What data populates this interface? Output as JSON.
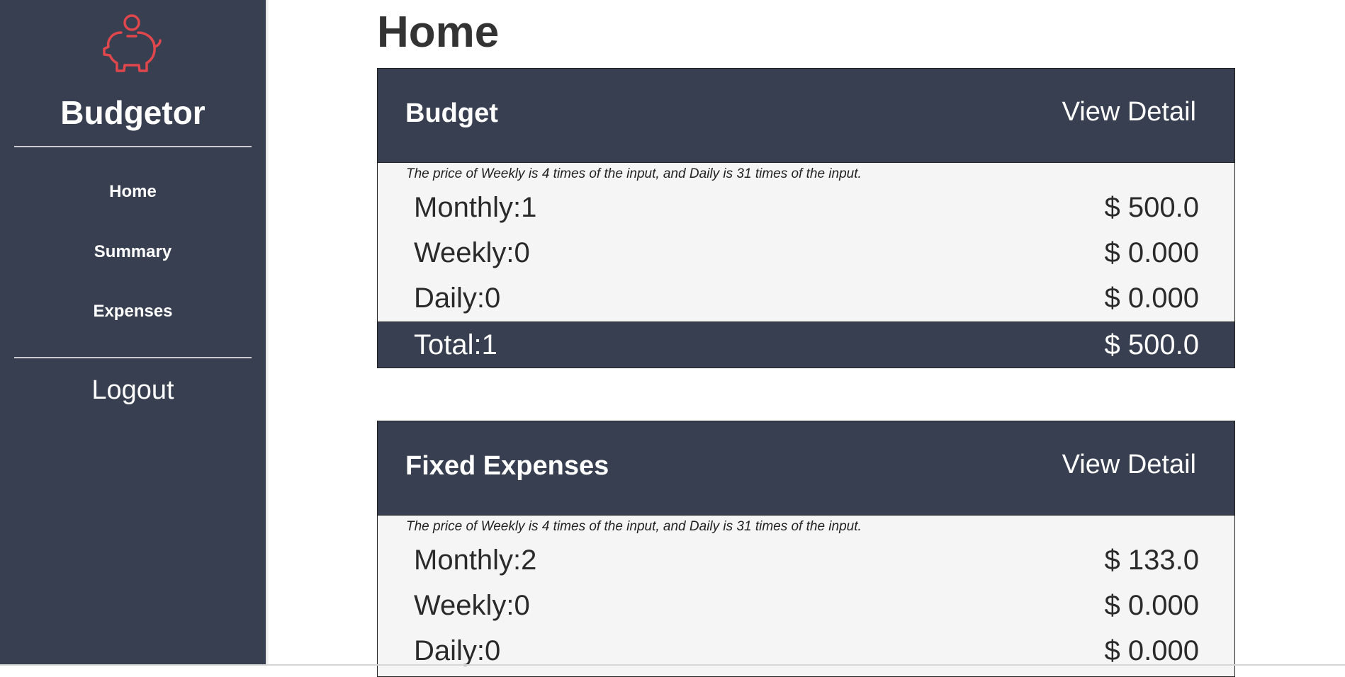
{
  "sidebar": {
    "logo_icon": "piggy-bank-icon",
    "brand": "Budgetor",
    "nav": [
      {
        "label": "Home"
      },
      {
        "label": "Summary"
      },
      {
        "label": "Expenses"
      }
    ],
    "logout": "Logout"
  },
  "page": {
    "title": "Home"
  },
  "cards": [
    {
      "title": "Budget",
      "view_detail": "View Detail",
      "note": "The price of Weekly is 4 times of the input, and Daily is 31 times of the input.",
      "rows": [
        {
          "label": "Monthly:1",
          "amount": "$ 500.0"
        },
        {
          "label": "Weekly:0",
          "amount": "$ 0.000"
        },
        {
          "label": "Daily:0",
          "amount": "$ 0.000"
        }
      ],
      "total": {
        "label": "Total:1",
        "amount": "$ 500.0"
      }
    },
    {
      "title": "Fixed Expenses",
      "view_detail": "View Detail",
      "note": "The price of Weekly is 4 times of the input, and Daily is 31 times of the input.",
      "rows": [
        {
          "label": "Monthly:2",
          "amount": "$ 133.0"
        },
        {
          "label": "Weekly:0",
          "amount": "$ 0.000"
        },
        {
          "label": "Daily:0",
          "amount": "$ 0.000"
        }
      ]
    }
  ],
  "colors": {
    "sidebar_bg": "#383f50",
    "accent_logo": "#e0474c",
    "card_body_bg": "#f5f5f5"
  }
}
